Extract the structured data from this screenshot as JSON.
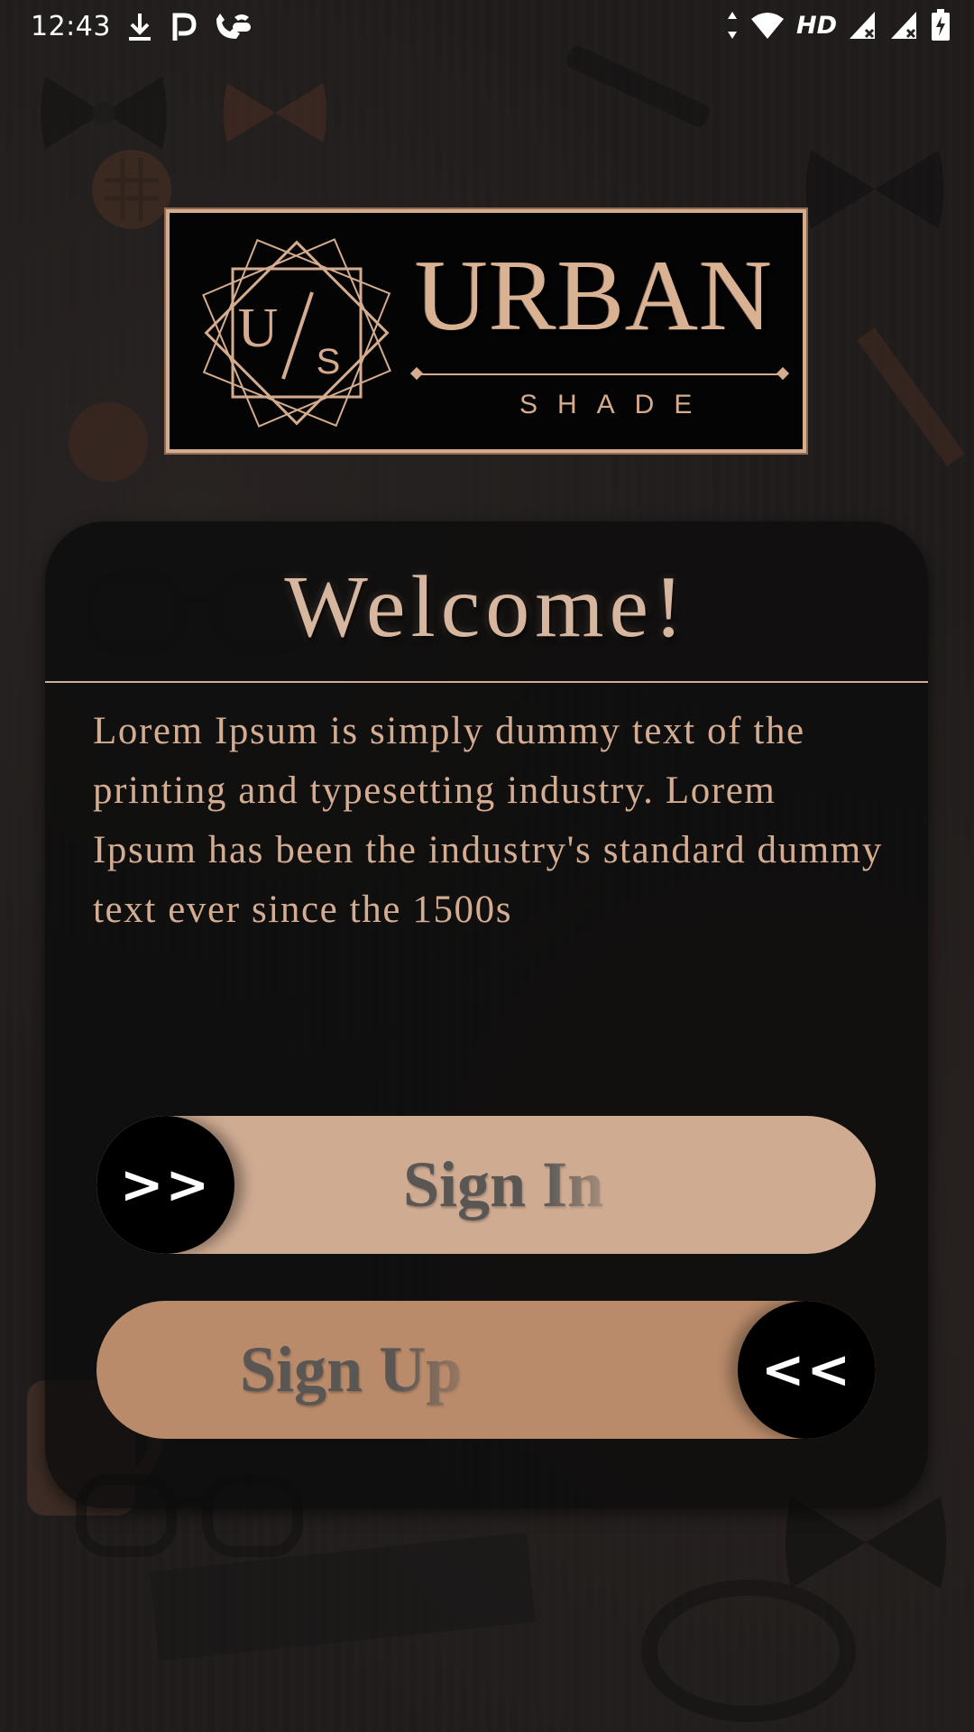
{
  "status_bar": {
    "time": "12:43",
    "left_icons": [
      "download-icon",
      "p-app-icon",
      "wifi-calling-icon"
    ],
    "right_icons": [
      "data-arrows-icon",
      "wifi-icon",
      "signal-x-icon",
      "signal-x-icon",
      "battery-charging-icon"
    ],
    "hd_label": "HD"
  },
  "logo": {
    "monogram_left": "U",
    "monogram_right": "S",
    "word": "URBAN",
    "sub": "SHADE"
  },
  "welcome": {
    "title": "Welcome!",
    "body": "Lorem Ipsum is simply dummy text of the printing and typesetting industry. Lorem Ipsum has been the industry's standard dummy text ever since the 1500s"
  },
  "buttons": {
    "sign_in": {
      "label": "Sign In",
      "knob": ">>"
    },
    "sign_up": {
      "label": "Sign Up",
      "knob": "<<"
    }
  },
  "colors": {
    "accent": "#d6b69e",
    "sign_in_bg": "#cfab92",
    "sign_up_bg": "#b98b6b",
    "knob": "#000000"
  }
}
